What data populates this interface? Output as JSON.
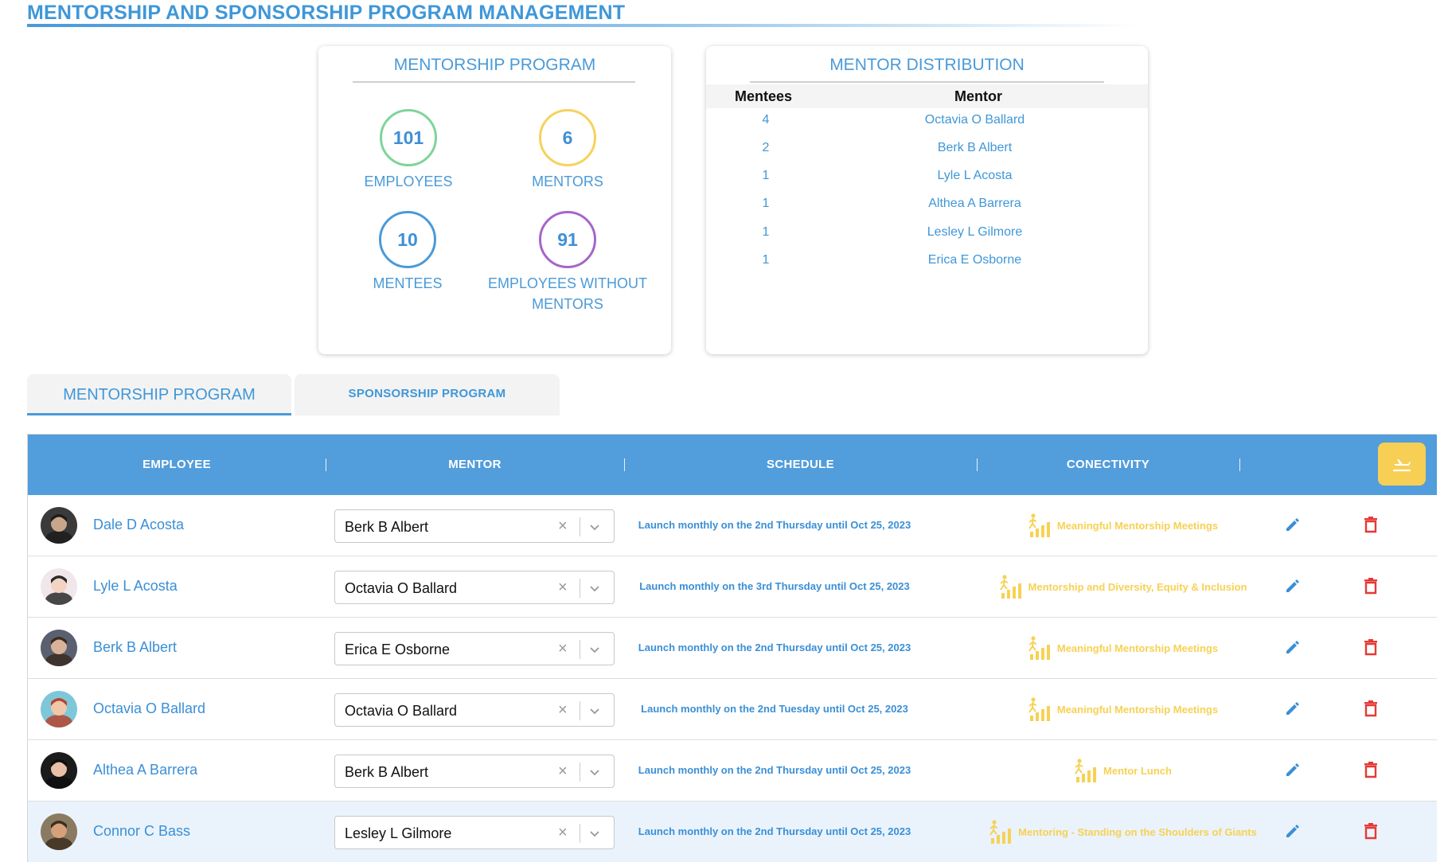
{
  "page": {
    "title": "MENTORSHIP AND SPONSORSHIP PROGRAM MANAGEMENT"
  },
  "program_card": {
    "title": "MENTORSHIP PROGRAM",
    "stats": [
      {
        "value": "101",
        "label": "EMPLOYEES",
        "color": "#7fd49a"
      },
      {
        "value": "6",
        "label": "MENTORS",
        "color": "#f6d25d"
      },
      {
        "value": "10",
        "label": "MENTEES",
        "color": "#4a9ad8"
      },
      {
        "value": "91",
        "label": "EMPLOYEES WITHOUT MENTORS",
        "color": "#a566c9"
      }
    ]
  },
  "distribution_card": {
    "title": "MENTOR DISTRIBUTION",
    "headers": {
      "mentees": "Mentees",
      "mentor": "Mentor"
    },
    "rows": [
      {
        "mentees": "4",
        "mentor": "Octavia O Ballard"
      },
      {
        "mentees": "2",
        "mentor": "Berk B Albert"
      },
      {
        "mentees": "1",
        "mentor": "Lyle L Acosta"
      },
      {
        "mentees": "1",
        "mentor": "Althea A Barrera"
      },
      {
        "mentees": "1",
        "mentor": "Lesley L Gilmore"
      },
      {
        "mentees": "1",
        "mentor": "Erica E Osborne"
      }
    ]
  },
  "tabs": {
    "mentorship": "MENTORSHIP PROGRAM",
    "sponsorship": "SPONSORSHIP PROGRAM"
  },
  "grid": {
    "headers": {
      "employee": "EMPLOYEE",
      "mentor": "MENTOR",
      "schedule": "SCHEDULE",
      "conectivity": "CONECTIVITY"
    },
    "rows": [
      {
        "employee": "Dale D Acosta",
        "mentor": "Berk B Albert",
        "schedule": "Launch monthly on the 2nd Thursday until Oct 25, 2023",
        "conectivity": "Meaningful Mentorship Meetings"
      },
      {
        "employee": "Lyle L Acosta",
        "mentor": "Octavia O Ballard",
        "schedule": "Launch monthly on the 3rd Thursday until Oct 25, 2023",
        "conectivity": "Mentorship and Diversity, Equity & Inclusion"
      },
      {
        "employee": "Berk B Albert",
        "mentor": "Erica E Osborne",
        "schedule": "Launch monthly on the 2nd Thursday until Oct 25, 2023",
        "conectivity": "Meaningful Mentorship Meetings"
      },
      {
        "employee": "Octavia O Ballard",
        "mentor": "Octavia O Ballard",
        "schedule": "Launch monthly on the 2nd Tuesday until Oct 25, 2023",
        "conectivity": "Meaningful Mentorship Meetings"
      },
      {
        "employee": "Althea A Barrera",
        "mentor": "Berk B Albert",
        "schedule": "Launch monthly on the 2nd Thursday until Oct 25, 2023",
        "conectivity": "Mentor Lunch"
      },
      {
        "employee": "Connor C Bass",
        "mentor": "Lesley L Gilmore",
        "schedule": "Launch monthly on the 2nd Thursday until Oct 25, 2023",
        "conectivity": "Mentoring - Standing on the Shoulders of Giants"
      }
    ]
  },
  "colors": {
    "accent": "#4a9ad8",
    "header_bg": "#529ddb",
    "conectivity": "#f7d154",
    "delete": "#e53935",
    "export": "#f7cf55"
  },
  "icons": {
    "edit": "pencil-icon",
    "delete": "trash-icon",
    "export": "export-icon",
    "conectivity": "growth-chart-icon",
    "clear": "close-icon",
    "dropdown": "chevron-down-icon"
  }
}
